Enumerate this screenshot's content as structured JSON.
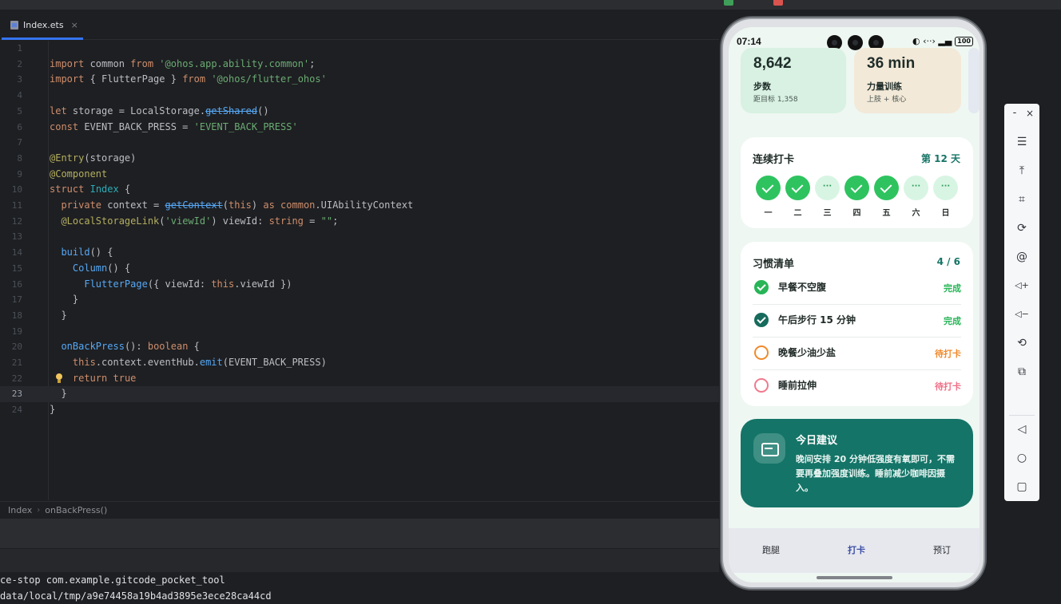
{
  "editor": {
    "tab_label": "Index.ets",
    "tab_close": "×",
    "lines": [
      {
        "n": "1"
      },
      {
        "n": "2"
      },
      {
        "n": "3"
      },
      {
        "n": "4"
      },
      {
        "n": "5"
      },
      {
        "n": "6"
      },
      {
        "n": "7"
      },
      {
        "n": "8"
      },
      {
        "n": "9"
      },
      {
        "n": "10"
      },
      {
        "n": "11"
      },
      {
        "n": "12"
      },
      {
        "n": "13"
      },
      {
        "n": "14"
      },
      {
        "n": "15"
      },
      {
        "n": "16"
      },
      {
        "n": "17"
      },
      {
        "n": "18"
      },
      {
        "n": "19"
      },
      {
        "n": "20"
      },
      {
        "n": "21"
      },
      {
        "n": "22"
      },
      {
        "n": "23"
      },
      {
        "n": "24"
      }
    ],
    "code": {
      "l2": [
        "import",
        " common ",
        "from",
        " ",
        "'@ohos.app.ability.common'",
        ";"
      ],
      "l3": [
        "import",
        " { FlutterPage } ",
        "from",
        " ",
        "'@ohos/flutter_ohos'"
      ],
      "l5": [
        "let",
        " storage = LocalStorage.",
        "getShared",
        "()"
      ],
      "l6": [
        "const",
        " EVENT_BACK_PRESS = ",
        "'EVENT_BACK_PRESS'"
      ],
      "l8": [
        "@Entry",
        "(storage)"
      ],
      "l9": [
        "@Component"
      ],
      "l10": [
        "struct",
        " ",
        "Index",
        " {"
      ],
      "l11": [
        "  ",
        "private",
        " context = ",
        "getContext",
        "(",
        "this",
        ") ",
        "as",
        " ",
        "common",
        ".UIAbilityContext"
      ],
      "l12": [
        "  ",
        "@LocalStorageLink",
        "(",
        "'viewId'",
        ") viewId: ",
        "string",
        " = ",
        "\"\"",
        ";"
      ],
      "l14": [
        "  ",
        "build",
        "() {"
      ],
      "l15": [
        "    ",
        "Column",
        "() {"
      ],
      "l16": [
        "      ",
        "FlutterPage",
        "({ viewId: ",
        "this",
        ".viewId })"
      ],
      "l17": [
        "    }"
      ],
      "l18": [
        "  }"
      ],
      "l20": [
        "  ",
        "onBackPress",
        "(): ",
        "boolean",
        " {"
      ],
      "l21": [
        "    ",
        "this",
        ".context.eventHub.",
        "emit",
        "(EVENT_BACK_PRESS)"
      ],
      "l22": [
        "    ",
        "return",
        " ",
        "true"
      ],
      "l23": [
        "  }"
      ],
      "l24": [
        "}"
      ]
    },
    "breadcrumb": [
      "Index",
      "onBackPress()"
    ],
    "breadcrumb_sep": "›",
    "terminal": [
      "ce-stop com.example.gitcode_pocket_tool",
      "data/local/tmp/a9e74458a19b4ad3895e3ece28ca44cd"
    ]
  },
  "phone": {
    "status": {
      "time": "07:14",
      "icons": "◐ ‹··› ▂▄",
      "battery": "100"
    },
    "stats": [
      {
        "value": "8,642",
        "label": "步数",
        "sub": "距目标 1,358",
        "bg": "#d8f1e2"
      },
      {
        "value": "36 min",
        "label": "力量训练",
        "sub": "上肢 + 核心",
        "bg": "#f3e9d8"
      }
    ],
    "streak": {
      "title": "连续打卡",
      "right": "第 12 天",
      "days": [
        {
          "label": "一",
          "state": "done",
          "mark": ""
        },
        {
          "label": "二",
          "state": "done",
          "mark": ""
        },
        {
          "label": "三",
          "state": "pend",
          "mark": "···"
        },
        {
          "label": "四",
          "state": "done",
          "mark": ""
        },
        {
          "label": "五",
          "state": "done",
          "mark": ""
        },
        {
          "label": "六",
          "state": "pend",
          "mark": "···"
        },
        {
          "label": "日",
          "state": "pend",
          "mark": "···"
        }
      ]
    },
    "habits": {
      "title": "习惯清单",
      "count": "4 / 6",
      "items": [
        {
          "name": "早餐不空腹",
          "status": "完成",
          "status_color": "#27b557",
          "icon": "ok-green"
        },
        {
          "name": "午后步行 15 分钟",
          "status": "完成",
          "status_color": "#27b557",
          "icon": "ok-teal"
        },
        {
          "name": "晚餐少油少盐",
          "status": "待打卡",
          "status_color": "#f08a2c",
          "icon": "ring-orange"
        },
        {
          "name": "睡前拉伸",
          "status": "待打卡",
          "status_color": "#ef6f86",
          "icon": "ring-pink"
        }
      ]
    },
    "advice": {
      "title": "今日建议",
      "text": "晚间安排 20 分钟低强度有氧即可，不需要再叠加强度训练。睡前减少咖啡因摄入。"
    },
    "nav": [
      {
        "label": "跑腿",
        "active": false
      },
      {
        "label": "打卡",
        "active": true
      },
      {
        "label": "预订",
        "active": false
      }
    ]
  },
  "side_toolbar": {
    "minimize": "-",
    "close": "×",
    "buttons": [
      {
        "icon": "menu-icon",
        "glyph": "☰"
      },
      {
        "icon": "pin-top-icon",
        "glyph": "⤒"
      },
      {
        "icon": "crop-icon",
        "glyph": "⌗"
      },
      {
        "icon": "rotate-icon",
        "glyph": "⟳"
      },
      {
        "icon": "at-icon",
        "glyph": "@"
      },
      {
        "icon": "volume-up-icon",
        "glyph": "◁+"
      },
      {
        "icon": "volume-down-icon",
        "glyph": "◁−"
      },
      {
        "icon": "rotate-device-icon",
        "glyph": "⟲"
      },
      {
        "icon": "screens-icon",
        "glyph": "⧉"
      },
      {
        "icon": "back-icon",
        "glyph": "◁"
      },
      {
        "icon": "home-icon",
        "glyph": "○"
      },
      {
        "icon": "recents-icon",
        "glyph": "▢"
      }
    ]
  }
}
